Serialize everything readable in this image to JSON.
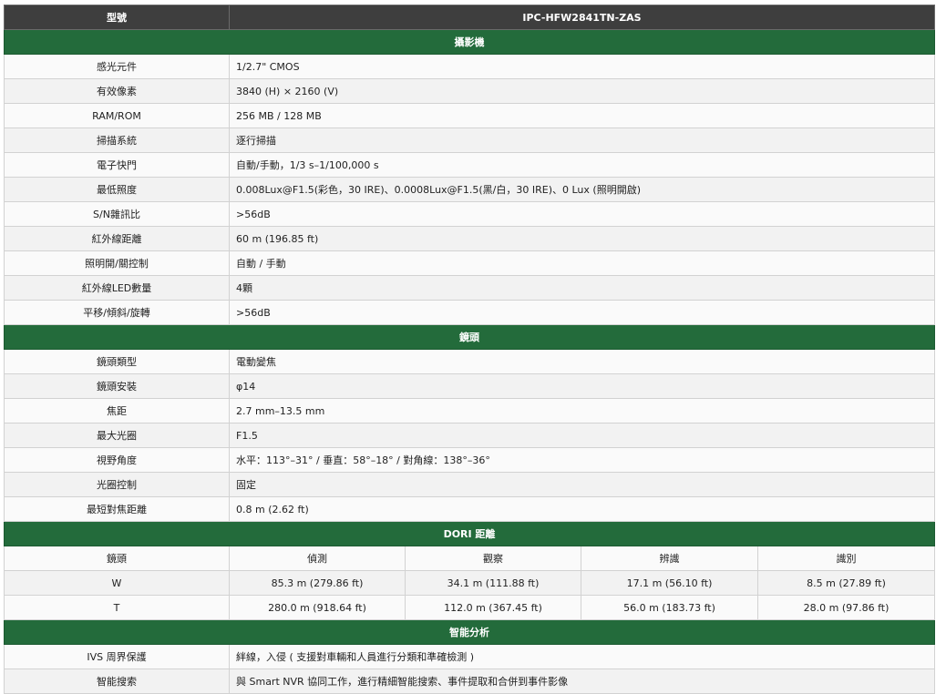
{
  "header": {
    "model_label": "型號",
    "model_value": "IPC-HFW2841TN-ZAS"
  },
  "sections": {
    "camera": {
      "title": "攝影機",
      "rows": [
        {
          "label": "感光元件",
          "value": "1/2.7\" CMOS"
        },
        {
          "label": "有效像素",
          "value": "3840 (H) × 2160 (V)"
        },
        {
          "label": "RAM/ROM",
          "value": "256 MB / 128 MB"
        },
        {
          "label": "掃描系統",
          "value": "逐行掃描"
        },
        {
          "label": "電子快門",
          "value": "自動/手動，1/3 s–1/100,000 s"
        },
        {
          "label": "最低照度",
          "value": "0.008Lux@F1.5(彩色，30 IRE)、0.0008Lux@F1.5(黑/白，30 IRE)、0 Lux (照明開啟)"
        },
        {
          "label": "S/N雜訊比",
          "value": ">56dB"
        },
        {
          "label": "紅外線距離",
          "value": "60 m (196.85 ft)"
        },
        {
          "label": "照明開/關控制",
          "value": "自動 / 手動"
        },
        {
          "label": "紅外線LED數量",
          "value": "4顆"
        },
        {
          "label": "平移/傾斜/旋轉",
          "value": ">56dB"
        }
      ]
    },
    "lens": {
      "title": "鏡頭",
      "rows": [
        {
          "label": "鏡頭類型",
          "value": "電動變焦"
        },
        {
          "label": "鏡頭安裝",
          "value": "φ14"
        },
        {
          "label": "焦距",
          "value": "2.7 mm–13.5 mm"
        },
        {
          "label": "最大光圈",
          "value": "F1.5"
        },
        {
          "label": "視野角度",
          "value": "水平：113°–31° / 垂直：58°–18° / 對角線：138°–36°"
        },
        {
          "label": "光圈控制",
          "value": "固定"
        },
        {
          "label": "最短對焦距離",
          "value": "0.8 m (2.62 ft)"
        }
      ]
    },
    "dori": {
      "title": "DORI 距離",
      "columns": [
        "鏡頭",
        "偵測",
        "觀察",
        "辨識",
        "識別"
      ],
      "rows": [
        [
          "W",
          "85.3 m (279.86 ft)",
          "34.1 m (111.88 ft)",
          "17.1 m (56.10 ft)",
          "8.5 m (27.89 ft)"
        ],
        [
          "T",
          "280.0 m (918.64 ft)",
          "112.0 m (367.45 ft)",
          "56.0 m (183.73 ft)",
          "28.0 m (97.86 ft)"
        ]
      ]
    },
    "analytics": {
      "title": "智能分析",
      "rows": [
        {
          "label": "IVS 周界保護",
          "value": "絆線，入侵 ( 支援對車輛和人員進行分類和準確檢測 )"
        },
        {
          "label": "智能搜索",
          "value": "與 Smart NVR 協同工作，進行精細智能搜索、事件提取和合併到事件影像"
        }
      ]
    }
  }
}
